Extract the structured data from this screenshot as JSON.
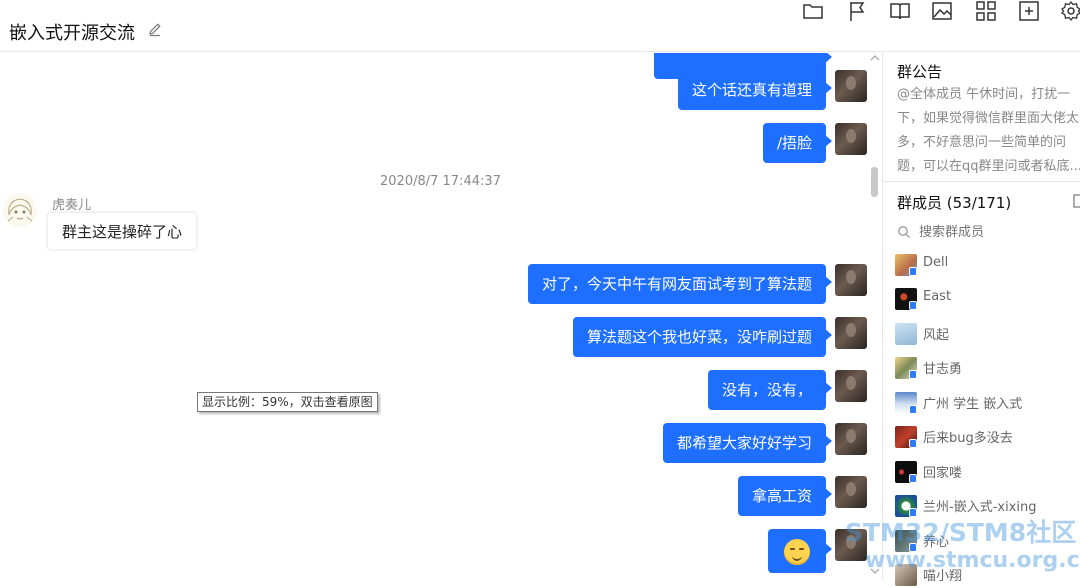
{
  "header": {
    "title": "嵌入式开源交流"
  },
  "chat": {
    "outgoing": [
      {
        "text": "这个话还真有道理"
      },
      {
        "text": "/捂脸"
      },
      {
        "text": "对了，今天中午有网友面试考到了算法题"
      },
      {
        "text": "算法题这个我也好菜，没咋刷过题"
      },
      {
        "text": "没有，没有，"
      },
      {
        "text": "都希望大家好好学习"
      },
      {
        "text": "拿高工资"
      }
    ],
    "timestamp": "2020/8/7 17:44:37",
    "incoming": {
      "name": "虎奏儿",
      "text": "群主这是操碎了心"
    },
    "zoom_tip": "显示比例：59%，双击查看原图"
  },
  "side": {
    "notice_title": "群公告",
    "notice_text": "@全体成员 午休时间，打扰一下，如果觉得微信群里面大佬太多，不好意思问一些简单的问题，可以在qq群里问或者私底...",
    "members_title": "群成员 (53/171)",
    "search_placeholder": "搜索群成员",
    "members": [
      {
        "name": "Dell"
      },
      {
        "name": "East"
      },
      {
        "name": "风起"
      },
      {
        "name": "甘志勇"
      },
      {
        "name": "广州 学生 嵌入式"
      },
      {
        "name": "后来bug多没去"
      },
      {
        "name": "回家喽"
      },
      {
        "name": "兰州-嵌入式-xixing"
      },
      {
        "name": "养心"
      },
      {
        "name": "喵小翔"
      }
    ]
  },
  "watermark": {
    "line1": "STM32/STM8社区",
    "line2": "www.stmcu.org.cn"
  },
  "colors": {
    "accent": "#1e6fff",
    "badge": "#2f7bff"
  }
}
